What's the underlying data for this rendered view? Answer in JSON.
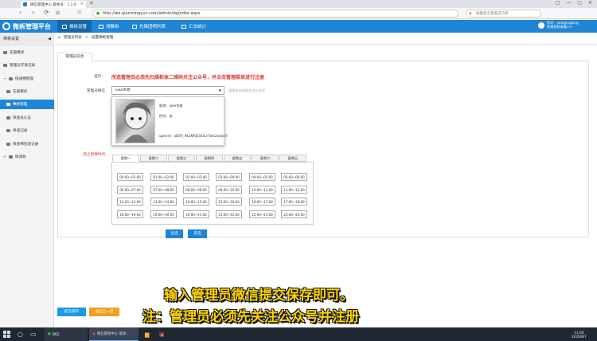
{
  "browser": {
    "tab_title": "微信管理中心 版本号：1.2.0",
    "tab_close": "×",
    "new_tab": "+",
    "window_buttons": [
      "▢",
      "—",
      "▢",
      "✕"
    ],
    "url": "http://wx.qianmingyun.com/admin/wglndex.aspx",
    "search_placeholder": "被删安全重置成功第",
    "nav_icons": [
      "‹",
      "›",
      "⟳",
      "⌂",
      "☆"
    ]
  },
  "app": {
    "brand": "微柝管理平台",
    "top_nav": [
      "棉柝设置",
      "领舞柝",
      "先锋团明列表",
      "汇总统计"
    ],
    "user_line1": "您好：yangjingqing",
    "user_line2": "快速柝柝查看>>"
  },
  "sidebar": {
    "header": "棉柝设置",
    "collapse_icon": "◀",
    "items": [
      "在册模式",
      "管理员开锋记录",
      "快速棉管理",
      "在册模式",
      "棉柝管理",
      "快速员认证",
      "柝递记录",
      "快速棉签退记录",
      "柝调款"
    ]
  },
  "breadcrumb": {
    "items": [
      "管理员列表",
      "设置棉柝管理"
    ],
    "sep": ">"
  },
  "panel": {
    "tab": "管理员信息",
    "notice_label": "提示：",
    "notice_text": "所选管理员必须先扫描柜体二维码关注公众号，并点击管理菜单进行注册",
    "admin_label": "管理员微信",
    "select_value": "luke木易",
    "select_hint": "管理员必须先关注公众号",
    "card_nickname": "昵称：luke木易",
    "card_gender": "性别：女",
    "card_openid": "openid：oD0V_9k2NFiJC8ULe-Sxk2adjvsY",
    "time_label": "禁止借棉时间",
    "days": [
      "星期一",
      "星期二",
      "星期三",
      "星期四",
      "星期五",
      "星期六",
      "星期日"
    ],
    "slots": [
      "00:00~01:00",
      "01:00~02:00",
      "02:00~03:00",
      "03:00~04:00",
      "04:00~05:00",
      "05:00~06:00",
      "06:00~07:00",
      "07:00~08:00",
      "08:00~09:00",
      "09:00~10:00",
      "10:00~11:00",
      "11:00~12:00",
      "12:00~13:00",
      "13:00~14:00",
      "14:00~15:00",
      "15:00~16:00",
      "16:00~17:00",
      "17:00~18:00",
      "18:00~19:00",
      "19:00~20:00",
      "20:00~21:00",
      "21:00~22:00",
      "22:00~23:00",
      "23:00~24:00"
    ],
    "select_all": "全选",
    "invert": "反选"
  },
  "actions": {
    "submit": "提交保存",
    "back": "返回上一页"
  },
  "captions": {
    "line1": "输入管理员微信提交保存即可。",
    "line2": "注：管理员必须先关注公众号并注册"
  },
  "taskbar": {
    "app_wechat": "微信",
    "app_browser": "微信管理中心 版本...",
    "time": "11:04",
    "date": "2020/8/7"
  }
}
